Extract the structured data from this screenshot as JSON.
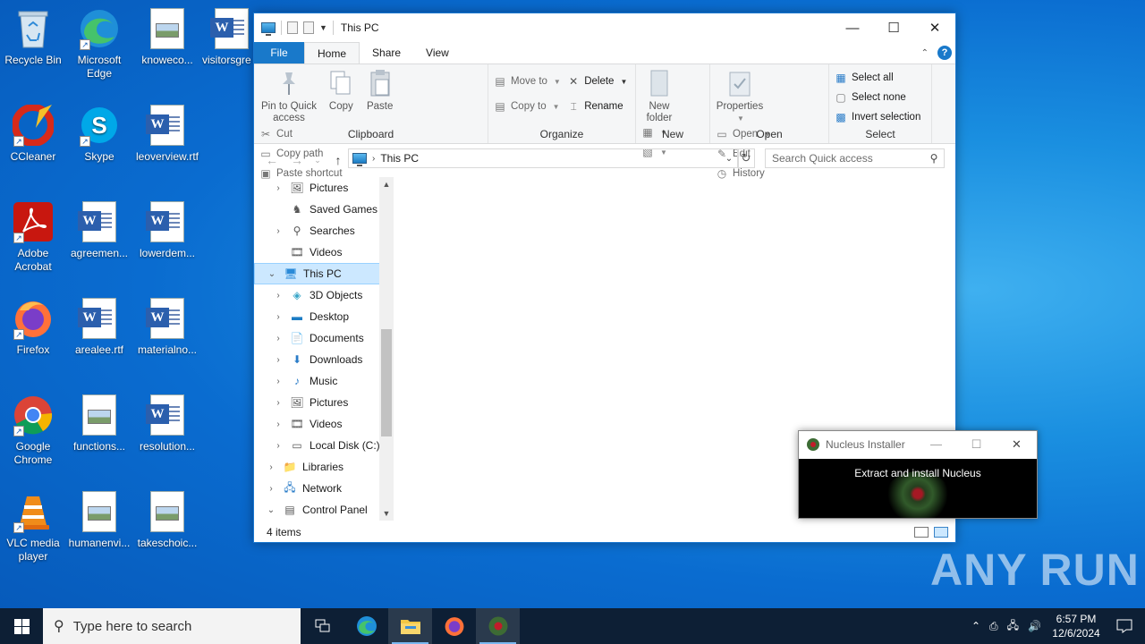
{
  "desktop": {
    "icons": [
      {
        "label": "Recycle Bin"
      },
      {
        "label": "Microsoft Edge"
      },
      {
        "label": "knoweco..."
      },
      {
        "label": "visitorsgre"
      },
      {
        "label": "CCleaner"
      },
      {
        "label": "Skype"
      },
      {
        "label": "leoverview.rtf"
      },
      {
        "label": "Adobe Acrobat"
      },
      {
        "label": "agreemen..."
      },
      {
        "label": "lowerdem..."
      },
      {
        "label": "Firefox"
      },
      {
        "label": "arealee.rtf"
      },
      {
        "label": "materialno..."
      },
      {
        "label": "Google Chrome"
      },
      {
        "label": "functions..."
      },
      {
        "label": "resolution..."
      },
      {
        "label": "VLC media player"
      },
      {
        "label": "humanenvi..."
      },
      {
        "label": "takeschoic..."
      }
    ]
  },
  "explorer": {
    "title": "This PC",
    "tabs": [
      "File",
      "Home",
      "Share",
      "View"
    ],
    "ribbon": {
      "clipboard": {
        "label": "Clipboard",
        "pin": "Pin to Quick access",
        "copy": "Copy",
        "paste": "Paste",
        "cut": "Cut",
        "copy_path": "Copy path",
        "paste_shortcut": "Paste shortcut"
      },
      "organize": {
        "label": "Organize",
        "move_to": "Move to",
        "copy_to": "Copy to",
        "delete": "Delete",
        "rename": "Rename"
      },
      "new": {
        "label": "New",
        "new_folder": "New folder"
      },
      "open": {
        "label": "Open",
        "properties": "Properties",
        "open": "Open",
        "edit": "Edit",
        "history": "History"
      },
      "select": {
        "label": "Select",
        "select_all": "Select all",
        "select_none": "Select none",
        "invert": "Invert selection"
      }
    },
    "address": "This PC",
    "search_placeholder": "Search Quick access",
    "tree": [
      {
        "label": "Pictures",
        "expander": "›",
        "level": 2
      },
      {
        "label": "Saved Games",
        "expander": "",
        "level": 2
      },
      {
        "label": "Searches",
        "expander": "›",
        "level": 2
      },
      {
        "label": "Videos",
        "expander": "",
        "level": 2
      },
      {
        "label": "This PC",
        "expander": "⌄",
        "level": 1,
        "selected": true
      },
      {
        "label": "3D Objects",
        "expander": "›",
        "level": 2
      },
      {
        "label": "Desktop",
        "expander": "›",
        "level": 2
      },
      {
        "label": "Documents",
        "expander": "›",
        "level": 2
      },
      {
        "label": "Downloads",
        "expander": "›",
        "level": 2
      },
      {
        "label": "Music",
        "expander": "›",
        "level": 2
      },
      {
        "label": "Pictures",
        "expander": "›",
        "level": 2
      },
      {
        "label": "Videos",
        "expander": "›",
        "level": 2
      },
      {
        "label": "Local Disk (C:)",
        "expander": "›",
        "level": 2
      },
      {
        "label": "Libraries",
        "expander": "›",
        "level": 1
      },
      {
        "label": "Network",
        "expander": "›",
        "level": 1
      },
      {
        "label": "Control Panel",
        "expander": "⌄",
        "level": 1
      }
    ],
    "status": "4 items"
  },
  "nucleus": {
    "title": "Nucleus Installer",
    "message": "Extract and install Nucleus"
  },
  "watermark": "ANY RUN",
  "taskbar": {
    "search_placeholder": "Type here to search",
    "time": "6:57 PM",
    "date": "12/6/2024"
  },
  "colors": {
    "accent": "#1979ca",
    "selection": "#cce8ff",
    "taskbar": "#0d1f35"
  }
}
